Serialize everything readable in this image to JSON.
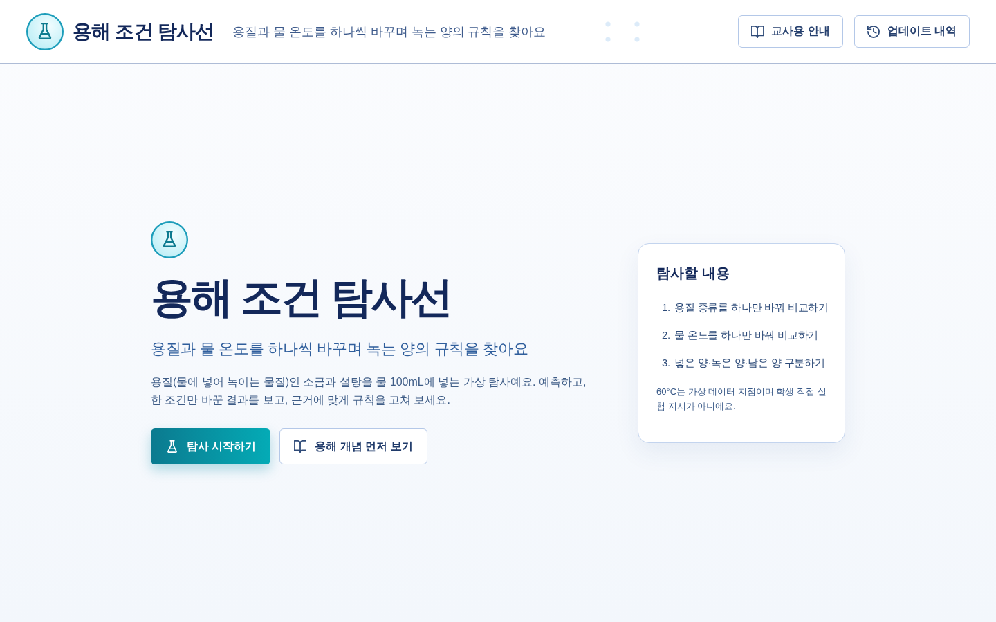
{
  "header": {
    "title": "용해 조건 탐사선",
    "subtitle": "용질과 물 온도를 하나씩 바꾸며 녹는 양의 규칙을 찾아요",
    "buttons": [
      {
        "kind": "guide",
        "label": "교사용 안내"
      },
      {
        "kind": "history",
        "label": "업데이트 내역"
      }
    ]
  },
  "hero": {
    "title": "용해 조건 탐사선",
    "subtitle": "용질과 물 온도를 하나씩 바꾸며 녹는 양의 규칙을 찾아요",
    "description": "용질(물에 넣어 녹이는 물질)인 소금과 설탕을 물 100mL에 넣는 가상 탐사예요. 예측하고, 한 조건만 바꾼 결과를 보고, 근거에 맞게 규칙을 고쳐 보세요.",
    "buttons": [
      {
        "kind": "primary",
        "label": "탐사 시작하기"
      },
      {
        "kind": "secondary",
        "label": "용해 개념 먼저 보기"
      }
    ]
  },
  "card": {
    "title": "탐사할 내용",
    "items": [
      {
        "number": "1.",
        "text": "용질 종류를 하나만 바꿔 비교하기"
      },
      {
        "number": "2.",
        "text": "물 온도를 하나만 바꿔 비교하기"
      },
      {
        "number": "3.",
        "text": "넣은 양·녹은 양·남은 양 구분하기"
      }
    ],
    "note": "60°C는 가상 데이터 지점이며 학생 직접 실험 지시가 아니에요."
  }
}
